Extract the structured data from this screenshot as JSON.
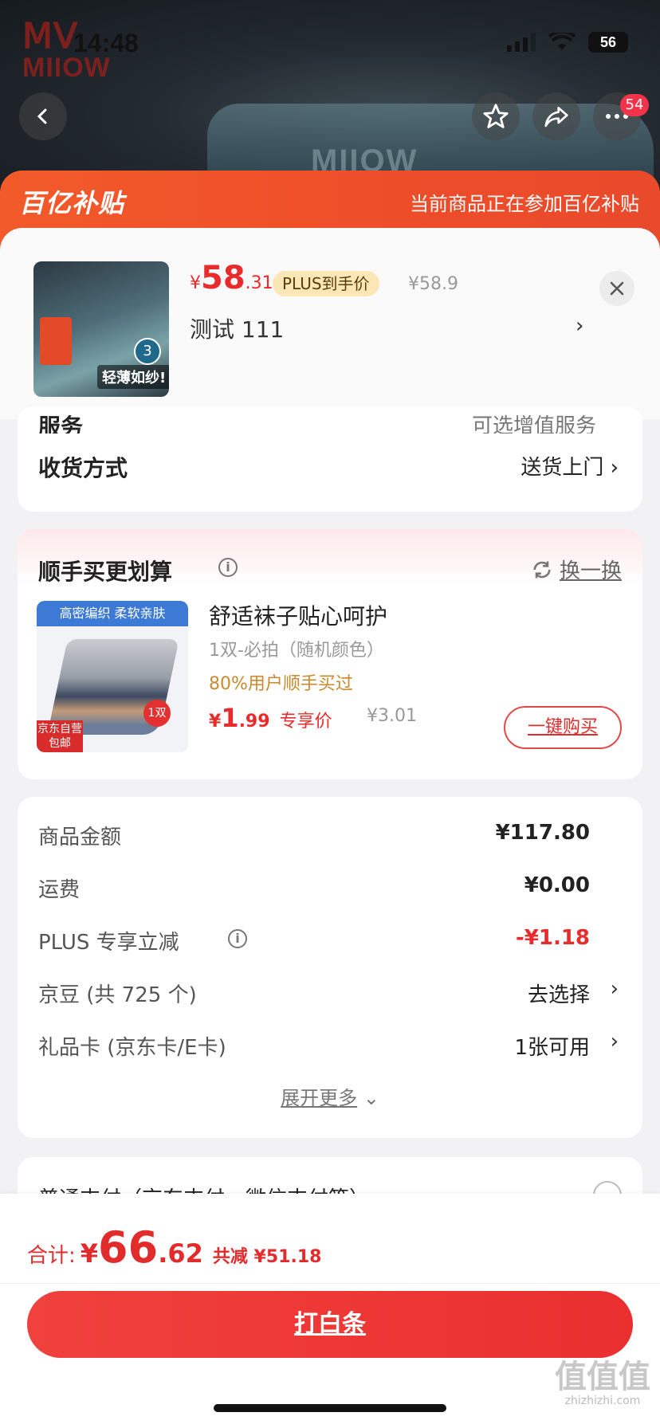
{
  "status_bar": {
    "time": "14:48",
    "battery": "56"
  },
  "hero": {
    "brand": "MIIOW",
    "cart_badge": "54"
  },
  "subsidy": {
    "logo": "百亿补贴",
    "text": "当前商品正在参加百亿补贴"
  },
  "product": {
    "price_currency": "¥",
    "price_int": "58",
    "price_dec": ".31",
    "plus_tag": "PLUS到手价",
    "original_price": "¥58.9",
    "spec": "测试  111",
    "thumb_slogan": "轻薄如纱!",
    "thumb_count": "3"
  },
  "delivery": {
    "service_label": "服务",
    "service_value": "可选增值服务",
    "shipping_label": "收货方式",
    "shipping_value": "送货上门"
  },
  "addon": {
    "title": "顺手买更划算",
    "swap_label": "换一换",
    "image_banner": "高密编织 柔软亲肤",
    "image_badge": "京东自营包邮",
    "image_count": "1双",
    "name": "舒适袜子贴心呵护",
    "spec": "1双-必拍（随机颜色）",
    "rate": "80%用户顺手买过",
    "price_currency": "¥",
    "price_int": "1",
    "price_dec": ".99",
    "price_label": "专享价",
    "original_price": "¥3.01",
    "buy_label": "一键购买"
  },
  "summary": {
    "rows": [
      {
        "label": "商品金额",
        "value": "¥117.80"
      },
      {
        "label": "运费",
        "value": "¥0.00"
      },
      {
        "label": "PLUS 专享立减",
        "value": "-¥1.18"
      },
      {
        "label": "京豆 (共 725 个)",
        "value": "去选择"
      },
      {
        "label": "礼品卡 (京东卡/E卡)",
        "value": "1张可用"
      }
    ],
    "expand_label": "展开更多"
  },
  "payment": {
    "label": "普通支付（京东支付、微信支付等）"
  },
  "bottom": {
    "total_label": "合计:",
    "total_currency": "¥",
    "total_int": "66",
    "total_dec": ".62",
    "saved": "共减 ¥51.18",
    "pay_button": "打白条"
  },
  "watermark": {
    "logo": "值值值",
    "site": "zhizhizhi.com"
  },
  "colors": {
    "accent_red": "#e92b2b",
    "subsidy_orange": "#f25a2a",
    "plus_gold": "#fbe7b6"
  }
}
